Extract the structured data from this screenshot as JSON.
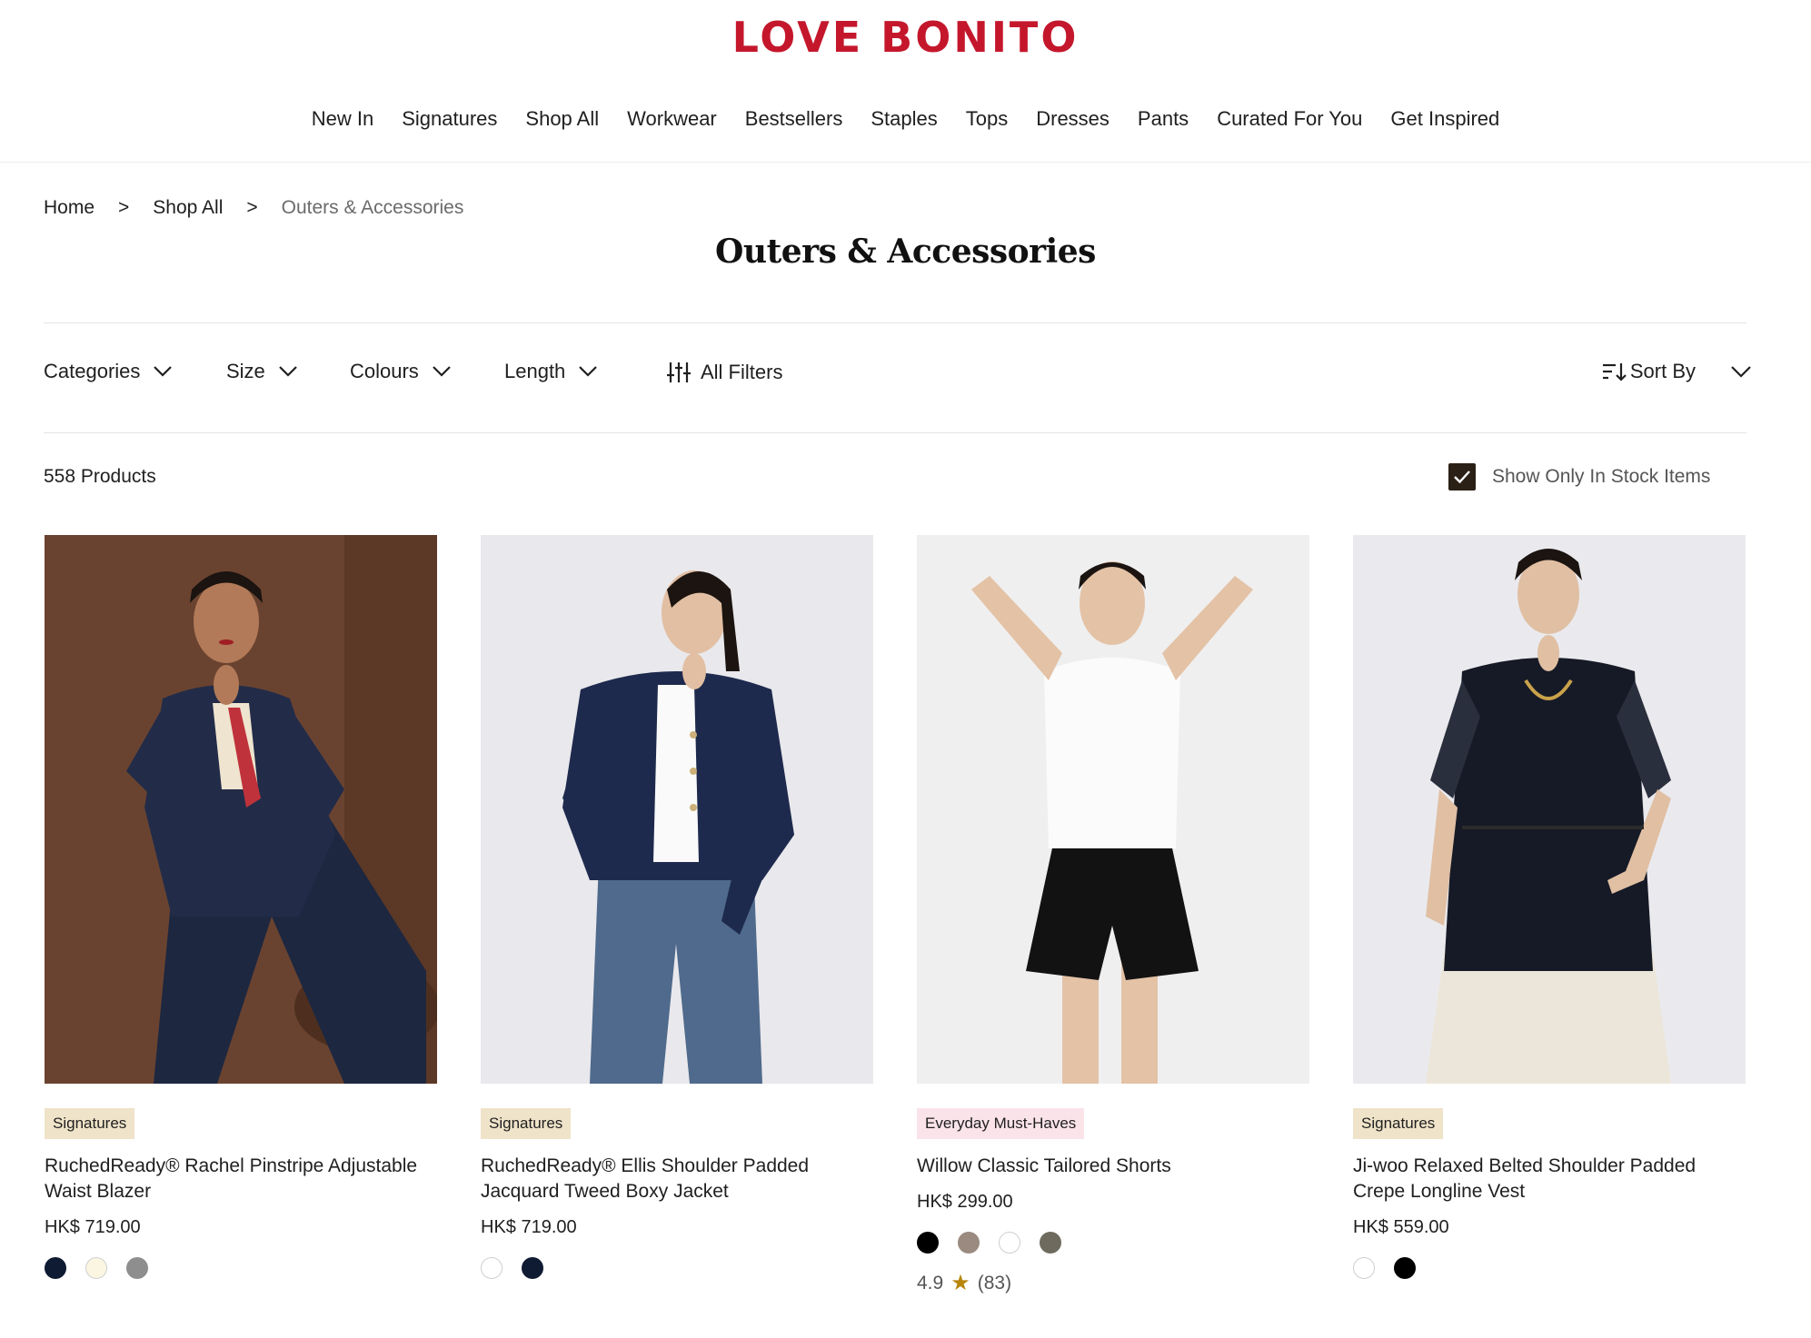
{
  "brand": {
    "logo": "LOVE BONITO",
    "color": "#c4172c"
  },
  "nav": [
    "New In",
    "Signatures",
    "Shop All",
    "Workwear",
    "Bestsellers",
    "Staples",
    "Tops",
    "Dresses",
    "Pants",
    "Curated For You",
    "Get Inspired"
  ],
  "breadcrumb": {
    "home": "Home",
    "sep": ">",
    "shop_all": "Shop All",
    "current": "Outers & Accessories"
  },
  "page_title": "Outers & Accessories",
  "filters": {
    "categories": "Categories",
    "size": "Size",
    "colours": "Colours",
    "length": "Length",
    "all_filters": "All Filters",
    "sort_by": "Sort By"
  },
  "product_count": "558 Products",
  "stock_toggle": {
    "label": "Show Only In Stock Items",
    "checked": true
  },
  "products": [
    {
      "badge": "Signatures",
      "name": "RuchedReady® Rachel Pinstripe Adjustable Waist Blazer",
      "price": "HK$ 719.00",
      "swatches": [
        "#0f1b33",
        "#fbf6e2",
        "#8e8e8e"
      ]
    },
    {
      "badge": "Signatures",
      "name": "RuchedReady® Ellis Shoulder Padded Jacquard Tweed Boxy Jacket",
      "price": "HK$ 719.00",
      "swatches": [
        "#ffffff",
        "#0f1b33"
      ]
    },
    {
      "badge": "Everyday Must-Haves",
      "name": "Willow Classic Tailored Shorts",
      "price": "HK$ 299.00",
      "swatches": [
        "#000000",
        "#9a8a80",
        "#ffffff",
        "#6e6b5e"
      ],
      "rating": {
        "score": "4.9",
        "count": "(83)"
      }
    },
    {
      "badge": "Signatures",
      "name": "Ji-woo Relaxed Belted Shoulder Padded Crepe Longline Vest",
      "price": "HK$ 559.00",
      "swatches": [
        "#ffffff",
        "#000000"
      ]
    }
  ],
  "colors": {
    "badge_signatures": "#efe3c9",
    "badge_must_haves": "#fbe3ea",
    "checkbox": "#2b2016"
  }
}
